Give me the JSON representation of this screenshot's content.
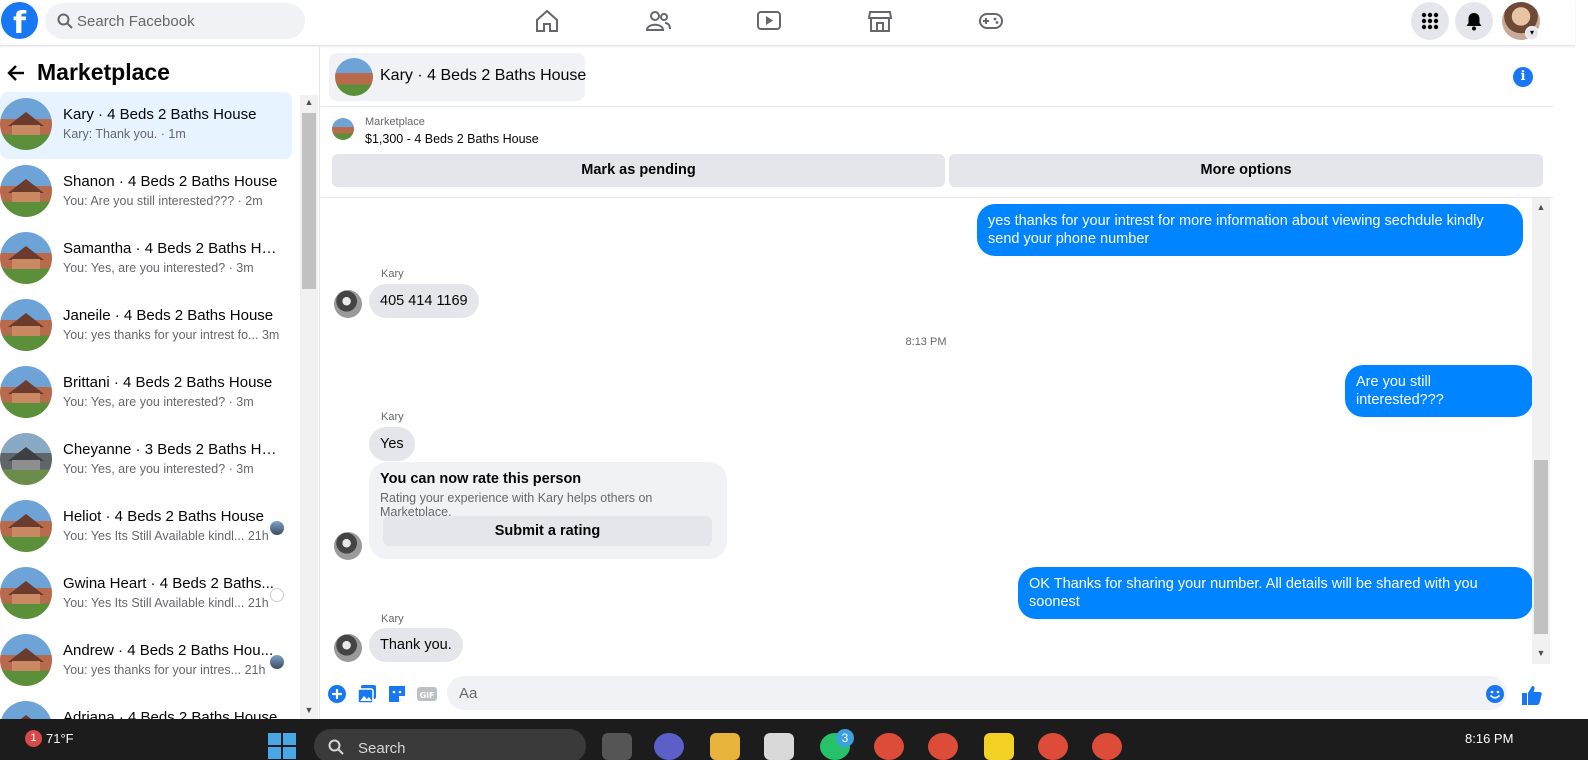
{
  "topbar": {
    "search_placeholder": "Search Facebook",
    "nav_icons": [
      "home-icon",
      "friends-icon",
      "watch-icon",
      "marketplace-icon",
      "gaming-icon"
    ],
    "right_icons": [
      "menu-grid-icon",
      "notifications-icon",
      "profile-avatar"
    ]
  },
  "sidebar": {
    "title": "Marketplace",
    "conversations": [
      {
        "name": "Kary · 4 Beds 2 Baths House",
        "preview": "Kary: Thank you. · 1m",
        "active": true
      },
      {
        "name": "Shanon · 4 Beds 2 Baths House",
        "preview": "You: Are you still interested??? · 2m"
      },
      {
        "name": "Samantha · 4 Beds 2 Baths Hou...",
        "preview": "You: Yes, are you interested? · 3m"
      },
      {
        "name": "Janeile · 4 Beds 2 Baths House",
        "preview": "You: yes thanks for your intrest fo...  3m"
      },
      {
        "name": "Brittani · 4 Beds 2 Baths House",
        "preview": "You: Yes, are you interested? · 3m"
      },
      {
        "name": "Cheyanne · 3 Beds 2 Baths House",
        "preview": "You: Yes, are you interested? · 3m"
      },
      {
        "name": "Heliot · 4 Beds 2 Baths House",
        "preview": "You: Yes Its Still Available kindl...  21h"
      },
      {
        "name": "Gwina Heart · 4 Beds 2 Baths...",
        "preview": "You: Yes Its Still Available kindl...  21h"
      },
      {
        "name": "Andrew · 4 Beds 2 Baths Hou...",
        "preview": "You: yes thanks for your intres...  21h"
      },
      {
        "name": "Adriana · 4 Beds 2 Baths House",
        "preview": ""
      }
    ]
  },
  "chat": {
    "title": "Kary · 4 Beds 2 Baths House",
    "listing_source": "Marketplace",
    "listing_title": "$1,300 - 4 Beds 2 Baths House",
    "btn_pending": "Mark as pending",
    "btn_more": "More options",
    "messages": {
      "out1": "yes thanks for your intrest for more information about viewing sechdule kindly send your phone number",
      "sender": "Kary",
      "in1": "405 414 1169",
      "time": "8:13 PM",
      "out2": "Are you still interested???",
      "in2": "Yes",
      "rating_title": "You can now rate this person",
      "rating_sub": "Rating your experience with Kary helps others on Marketplace.",
      "rating_btn": "Submit a rating",
      "out3": "OK Thanks for sharing your number. All details will be shared with you soonest",
      "in3": "Thank you."
    },
    "composer_placeholder": "Aa"
  },
  "taskbar": {
    "badge": "1",
    "weather": "71°F",
    "search": "Search",
    "chrome_badge": "3",
    "clock": "8:16 PM"
  },
  "colors": {
    "brand": "#1877f2",
    "bubble_out": "#0084ff",
    "bubble_in": "#e4e6eb"
  }
}
